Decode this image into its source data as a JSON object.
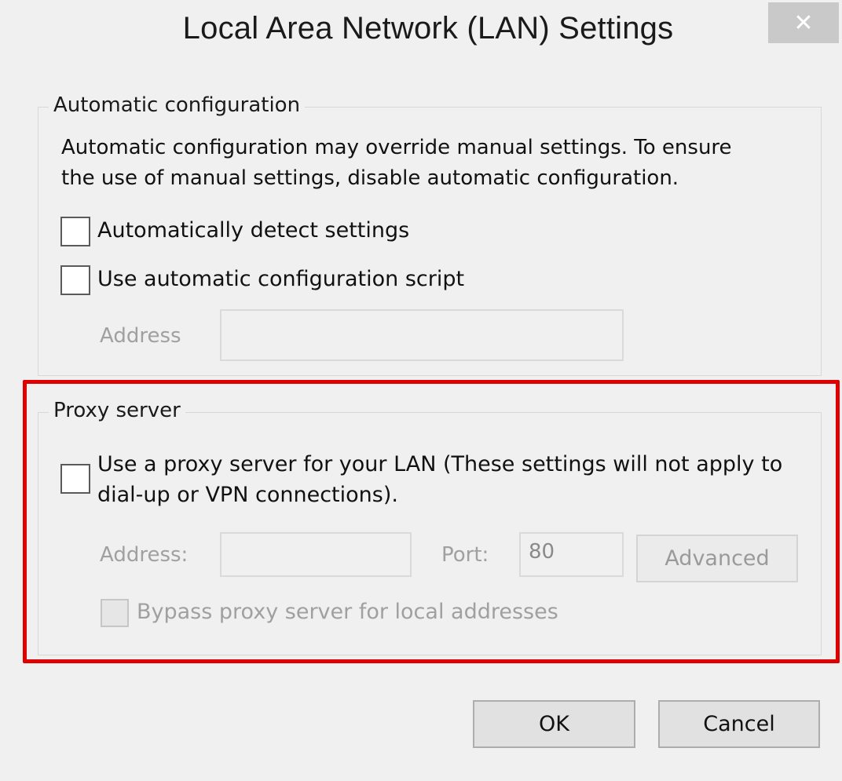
{
  "dialog": {
    "title": "Local Area Network (LAN) Settings",
    "close_glyph": "✕"
  },
  "automatic_configuration": {
    "group_label": "Automatic configuration",
    "description_line1": "Automatic configuration may override manual settings.  To ensure",
    "description_line2": "the use of manual settings, disable automatic configuration.",
    "detect_settings": {
      "label": "Automatically detect settings",
      "checked": false
    },
    "use_script": {
      "label": "Use automatic configuration script",
      "checked": false
    },
    "address_label": "Address",
    "address_value": ""
  },
  "proxy_server": {
    "group_label": "Proxy server",
    "use_proxy": {
      "label_line1": "Use a proxy server for your LAN (These settings will not apply to",
      "label_line2": "dial-up or VPN connections).",
      "checked": false
    },
    "address_label": "Address:",
    "address_value": "",
    "port_label": "Port:",
    "port_value": "80",
    "advanced_label": "Advanced",
    "bypass_local": {
      "label": "Bypass proxy server for local addresses",
      "checked": false
    }
  },
  "buttons": {
    "ok_label": "OK",
    "cancel_label": "Cancel"
  },
  "colors": {
    "highlight": "#e00000",
    "dialog_bg": "#f0f0f0",
    "disabled_text": "#a0a0a0"
  }
}
